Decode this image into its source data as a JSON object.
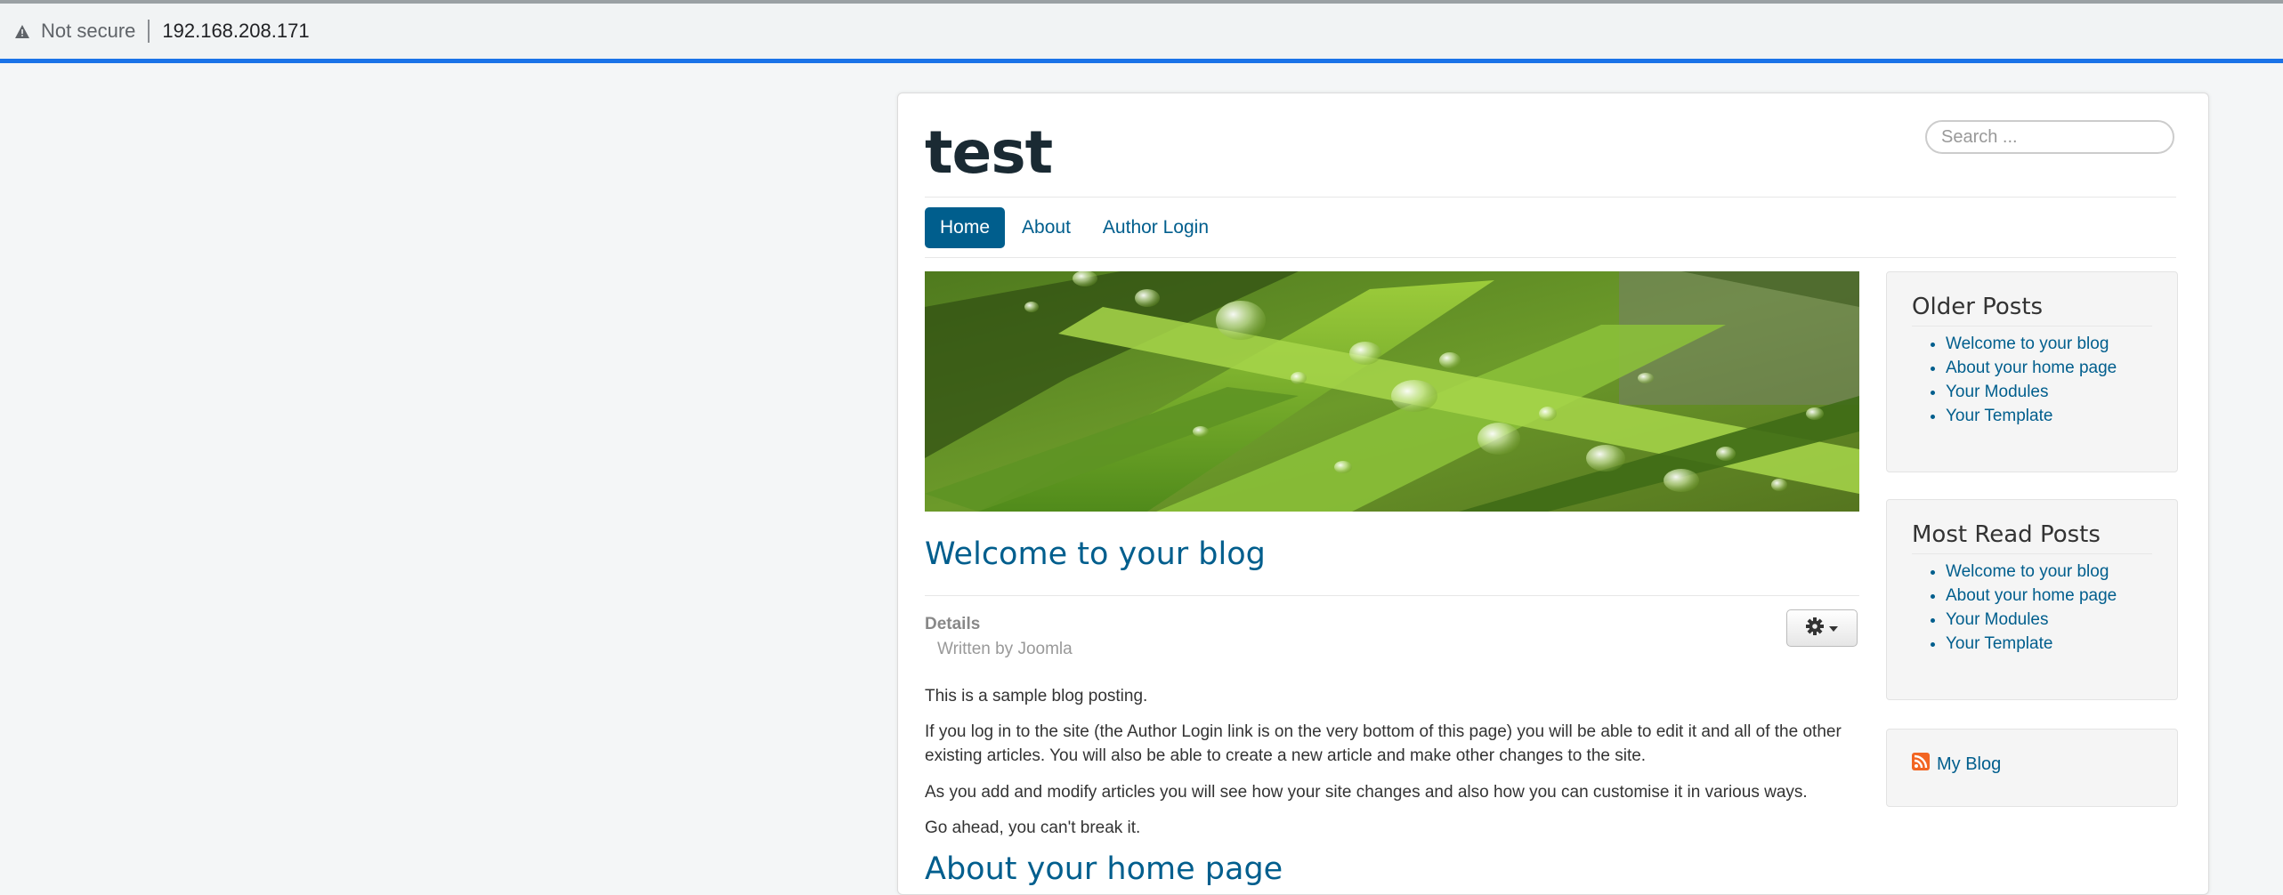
{
  "browser": {
    "security_label": "Not secure",
    "url": "192.168.208.171"
  },
  "site": {
    "title": "test",
    "search_placeholder": "Search ..."
  },
  "nav": {
    "items": [
      {
        "label": "Home",
        "active": true
      },
      {
        "label": "About",
        "active": false
      },
      {
        "label": "Author Login",
        "active": false
      }
    ]
  },
  "article": {
    "title": "Welcome to your blog",
    "details_label": "Details",
    "written_by": "Written by Joomla",
    "paragraphs": [
      "This is a sample blog posting.",
      "If you log in to the site (the Author Login link is on the very bottom of this page) you will be able to edit it and all of the other existing articles. You will also be able to create a new article and make other changes to the site.",
      "As you add and modify articles you will see how your site changes and also how you can customise it in various ways.",
      "Go ahead, you can't break it."
    ],
    "next_title": "About your home page"
  },
  "sidebar": {
    "older_posts": {
      "title": "Older Posts",
      "items": [
        "Welcome to your blog",
        "About your home page",
        "Your Modules",
        "Your Template"
      ]
    },
    "most_read": {
      "title": "Most Read Posts",
      "items": [
        "Welcome to your blog",
        "About your home page",
        "Your Modules",
        "Your Template"
      ]
    },
    "feed": {
      "label": "My Blog"
    }
  },
  "colors": {
    "link": "#005e8d",
    "browser_progress": "#1a73e8",
    "feed_icon": "#f26522"
  },
  "icons": [
    "warning-icon",
    "gear-icon",
    "caret-down-icon",
    "rss-feed-icon"
  ]
}
